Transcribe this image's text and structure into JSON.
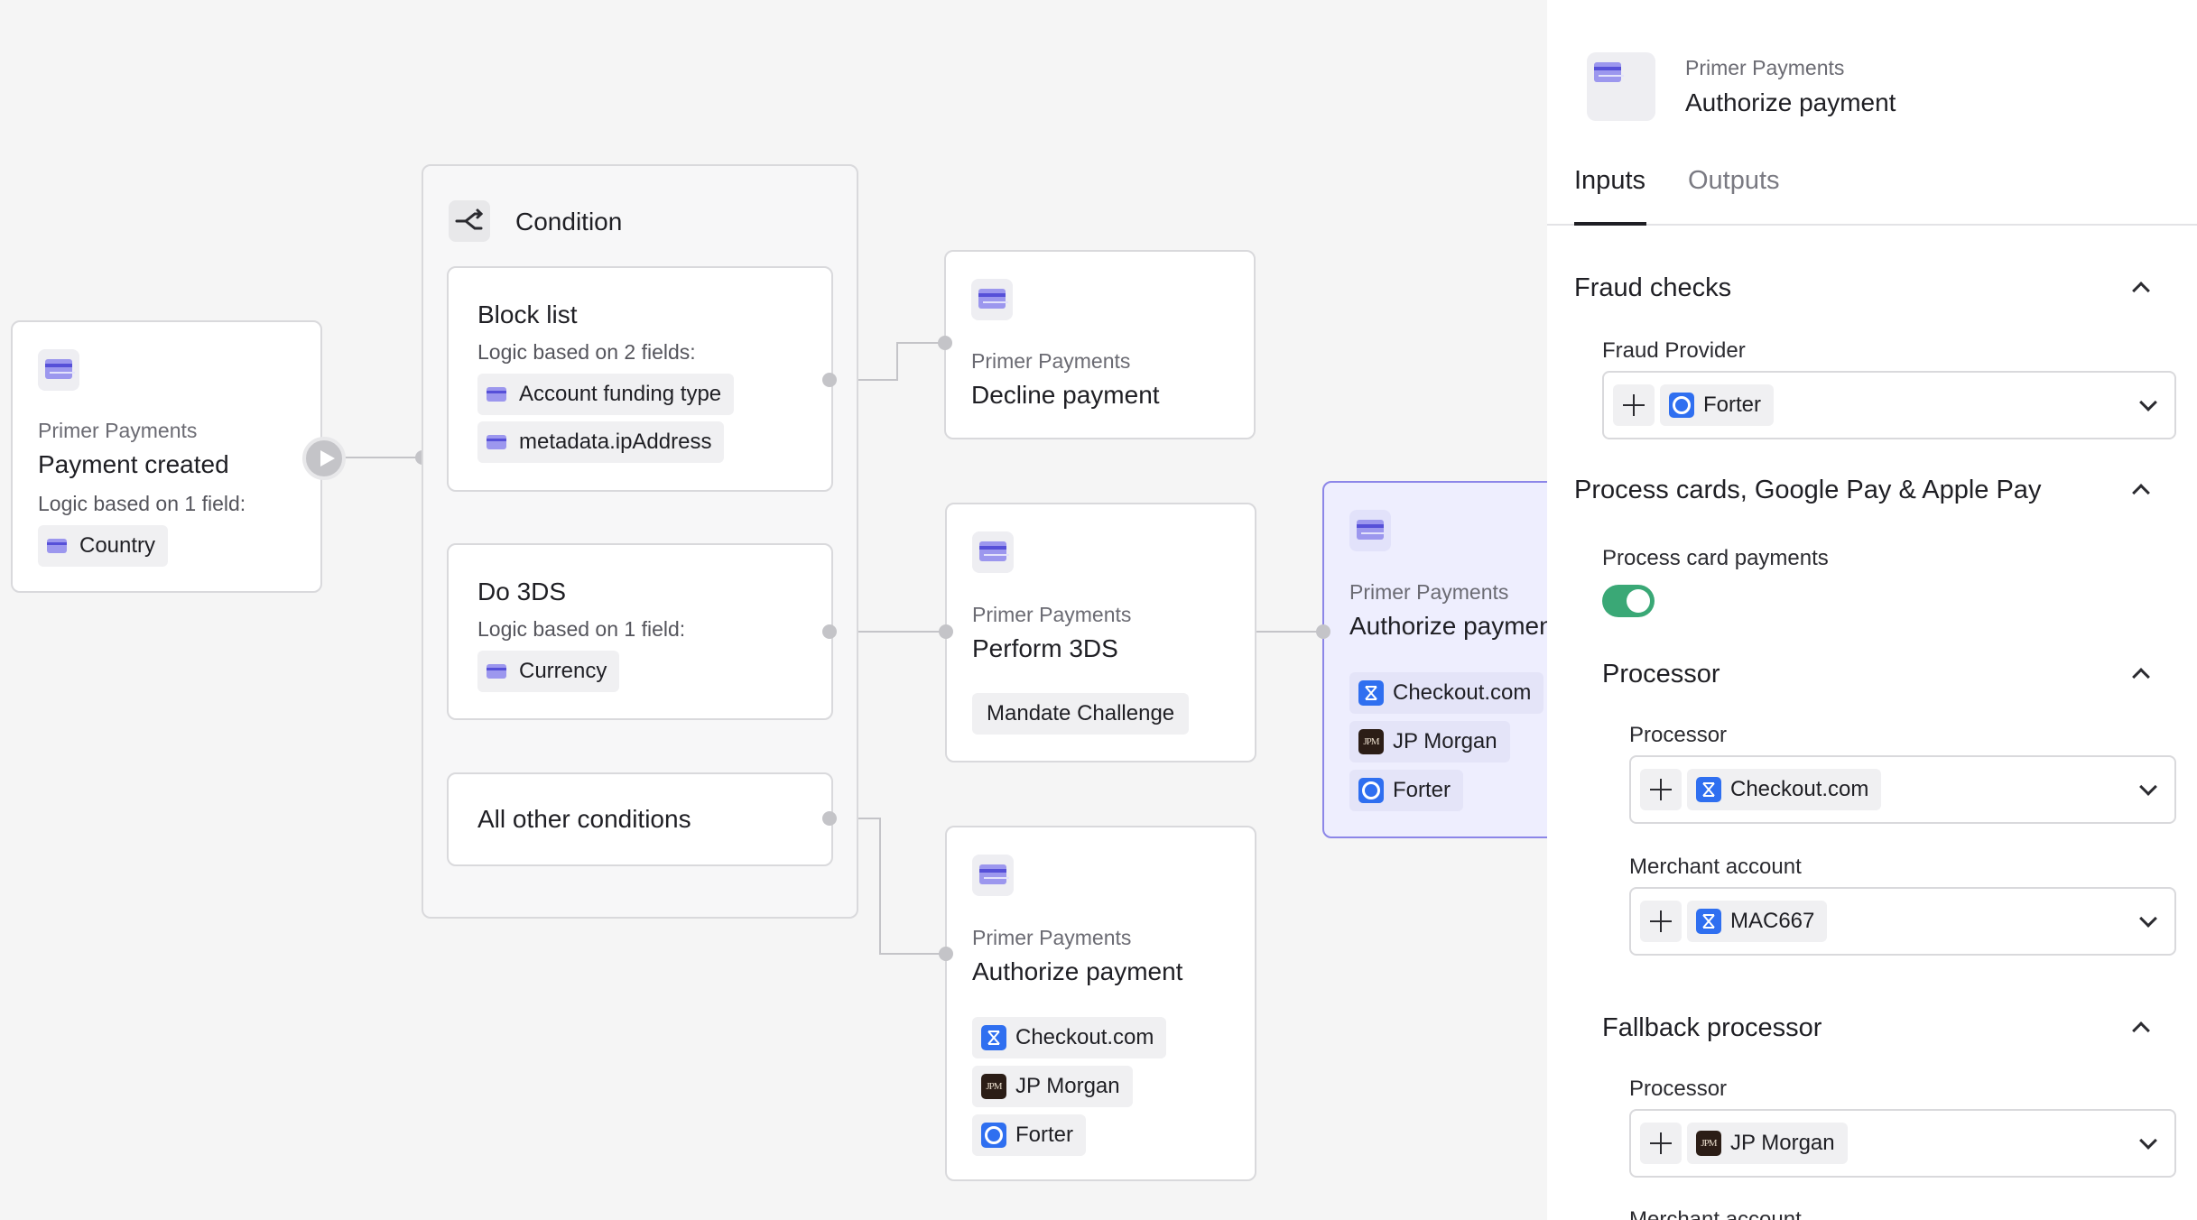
{
  "canvas": {
    "trigger": {
      "provider": "Primer Payments",
      "title": "Payment created",
      "logic": "Logic based on 1 field:",
      "fields": [
        "Country"
      ]
    },
    "condition": {
      "title": "Condition",
      "branches": [
        {
          "title": "Block list",
          "logic": "Logic based on 2 fields:",
          "fields": [
            "Account funding type",
            "metadata.ipAddress"
          ]
        },
        {
          "title": "Do 3DS",
          "logic": "Logic based on 1 field:",
          "fields": [
            "Currency"
          ]
        },
        {
          "title": "All other conditions"
        }
      ]
    },
    "actions": {
      "decline": {
        "provider": "Primer Payments",
        "title": "Decline payment"
      },
      "perform3ds": {
        "provider": "Primer Payments",
        "title": "Perform 3DS",
        "tag": "Mandate Challenge"
      },
      "authorize_other": {
        "provider": "Primer Payments",
        "title": "Authorize payment",
        "connections": [
          "Checkout.com",
          "JP Morgan",
          "Forter"
        ]
      },
      "authorize_selected": {
        "provider": "Primer Payments",
        "title": "Authorize payment",
        "connections": [
          "Checkout.com",
          "JP Morgan",
          "Forter"
        ]
      }
    }
  },
  "panel": {
    "header": {
      "provider": "Primer Payments",
      "title": "Authorize payment"
    },
    "tabs": [
      {
        "label": "Inputs",
        "active": true
      },
      {
        "label": "Outputs",
        "active": false
      }
    ],
    "sections": {
      "fraud": {
        "title": "Fraud checks",
        "provider_label": "Fraud Provider",
        "provider_value": "Forter"
      },
      "process": {
        "title": "Process cards, Google Pay & Apple Pay",
        "toggle_label": "Process card payments",
        "toggle_on": true,
        "processor": {
          "title": "Processor",
          "processor_label": "Processor",
          "processor_value": "Checkout.com",
          "merchant_label": "Merchant account",
          "merchant_value": "MAC667"
        },
        "fallback": {
          "title": "Fallback processor",
          "processor_label": "Processor",
          "processor_value": "JP Morgan",
          "merchant_label": "Merchant account"
        }
      }
    }
  },
  "logos": {
    "checkout": "checkout-logo",
    "jpmorgan": "JPM",
    "forter": "forter-logo"
  },
  "colors": {
    "accent": "#5650d8",
    "toggle": "#3aa876",
    "selected_bg": "#eeeefe",
    "selected_border": "#8c86e8"
  }
}
